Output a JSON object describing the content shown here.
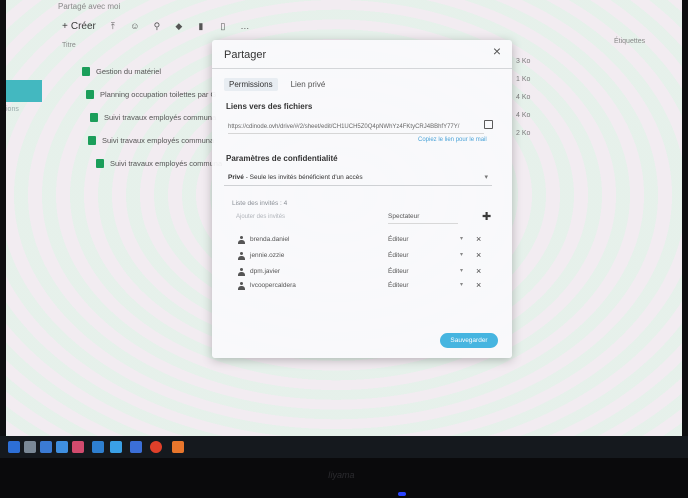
{
  "app": {
    "breadcrumb": "Partagé avec moi",
    "create_label": "Créer",
    "columns": {
      "name": "Titre",
      "labels": "Étiquettes"
    },
    "files": [
      {
        "name": "Gestion du matériel"
      },
      {
        "name": "Planning occupation toilettes par G"
      },
      {
        "name": "Suivi travaux employés communa"
      },
      {
        "name": "Suivi travaux employés communa"
      },
      {
        "name": "Suivi travaux employés communa"
      }
    ],
    "sizes": [
      "3 Ko",
      "1 Ko",
      "4 Ko",
      "4 Ko",
      "2 Ko"
    ],
    "left_nav_label": "ions"
  },
  "dialog": {
    "title": "Partager",
    "tabs": [
      {
        "label": "Permissions",
        "active": true
      },
      {
        "label": "Lien privé",
        "active": false
      }
    ],
    "links_section": "Liens vers des fichiers",
    "link_url": "https://cdinode.ovh/drive/#/2/sheet/edit/CH1UCH5Z0Q4pNWhYz4FKtyCRJ4BBhfY77Y/",
    "link_hint": "Copiez le lien pour le mail",
    "privacy_section": "Paramètres de confidentialité",
    "privacy_prefix": "Privé",
    "privacy_text": " - Seule les invités bénéficient d'un accès",
    "guests_label": "Liste des invités : 4",
    "add_placeholder": "Ajouter des invités",
    "default_role": "Spectateur",
    "guests": [
      {
        "name": "brenda.daniel",
        "role": "Éditeur"
      },
      {
        "name": "jennie.ozzie",
        "role": "Éditeur"
      },
      {
        "name": "dpm.javier",
        "role": "Éditeur"
      },
      {
        "name": "lvcoopercaldera",
        "role": "Éditeur"
      }
    ],
    "save_label": "Sauvegarder"
  },
  "monitor": {
    "brand": "Iiyama"
  },
  "colors": {
    "accent": "#46b5e0",
    "nav_active": "#43b8c0",
    "sheet_icon": "#1b9e5a"
  }
}
